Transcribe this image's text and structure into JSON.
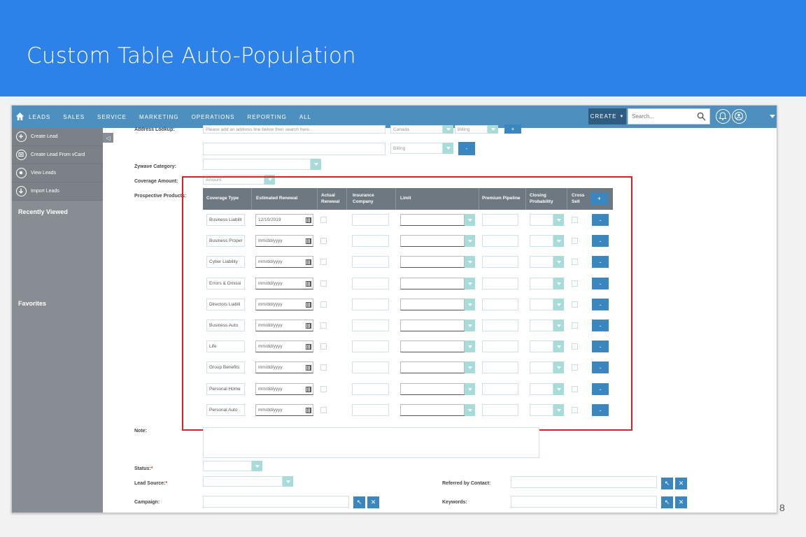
{
  "slide": {
    "title": "Custom Table Auto-Population",
    "page_number": "8"
  },
  "nav": {
    "items": [
      "LEADS",
      "SALES",
      "SERVICE",
      "MARKETING",
      "OPERATIONS",
      "REPORTING",
      "ALL"
    ],
    "create_label": "CREATE",
    "search_placeholder": "Search..."
  },
  "sidebar": {
    "actions": [
      "Create Lead",
      "Create Lead From vCard",
      "View Leads",
      "Import Leads"
    ],
    "recently_viewed": "Recently Viewed",
    "favorites": "Favorites"
  },
  "form": {
    "address_lookup_label": "Address Lookup:",
    "address_lookup_placeholder": "Please add an address line below then search here...",
    "country_value": "Canada",
    "billing_value_1": "Billing",
    "billing_value_2": "Billing",
    "zywave_label": "Zywave Category:",
    "coverage_amount_label": "Coverage Amount:",
    "coverage_amount_value": "Amount",
    "prospective_label": "Prospective Products:",
    "note_label": "Note:",
    "status_label": "Status:",
    "lead_source_label": "Lead Source:",
    "campaign_label": "Campaign:",
    "referred_label": "Referred by Contact:",
    "keywords_label": "Keywords:",
    "required_mark": "*"
  },
  "table": {
    "headers": {
      "coverage_type": "Coverage Type",
      "estimated_renewal": "Estimated Renewal",
      "actual_renewal": "Actual Renewal",
      "insurance_company": "Insurance Company",
      "limit": "Limit",
      "premium_pipeline": "Premium Pipeline",
      "closing_probability": "Closing Probability",
      "cross_sell": "Cross Sell"
    },
    "add_label": "+",
    "remove_label": "-",
    "rows": [
      {
        "coverage": "Business Liabilit",
        "renewal": "12/10/2019"
      },
      {
        "coverage": "Business Proper",
        "renewal": "mm/dd/yyyy"
      },
      {
        "coverage": "Cyber Liability",
        "renewal": "mm/dd/yyyy"
      },
      {
        "coverage": "Errors & Omissi",
        "renewal": "mm/dd/yyyy"
      },
      {
        "coverage": "Directors Liabili",
        "renewal": "mm/dd/yyyy"
      },
      {
        "coverage": "Business Auto",
        "renewal": "mm/dd/yyyy"
      },
      {
        "coverage": "Life",
        "renewal": "mm/dd/yyyy"
      },
      {
        "coverage": "Group Benefits",
        "renewal": "mm/dd/yyyy"
      },
      {
        "coverage": "Personal Home",
        "renewal": "mm/dd/yyyy"
      },
      {
        "coverage": "Personal Auto",
        "renewal": "mm/dd/yyyy"
      }
    ]
  },
  "colors": {
    "banner": "#2d82ea",
    "nav": "#4d8fbf",
    "button": "#3a86be",
    "highlight_box": "#e01e26"
  }
}
